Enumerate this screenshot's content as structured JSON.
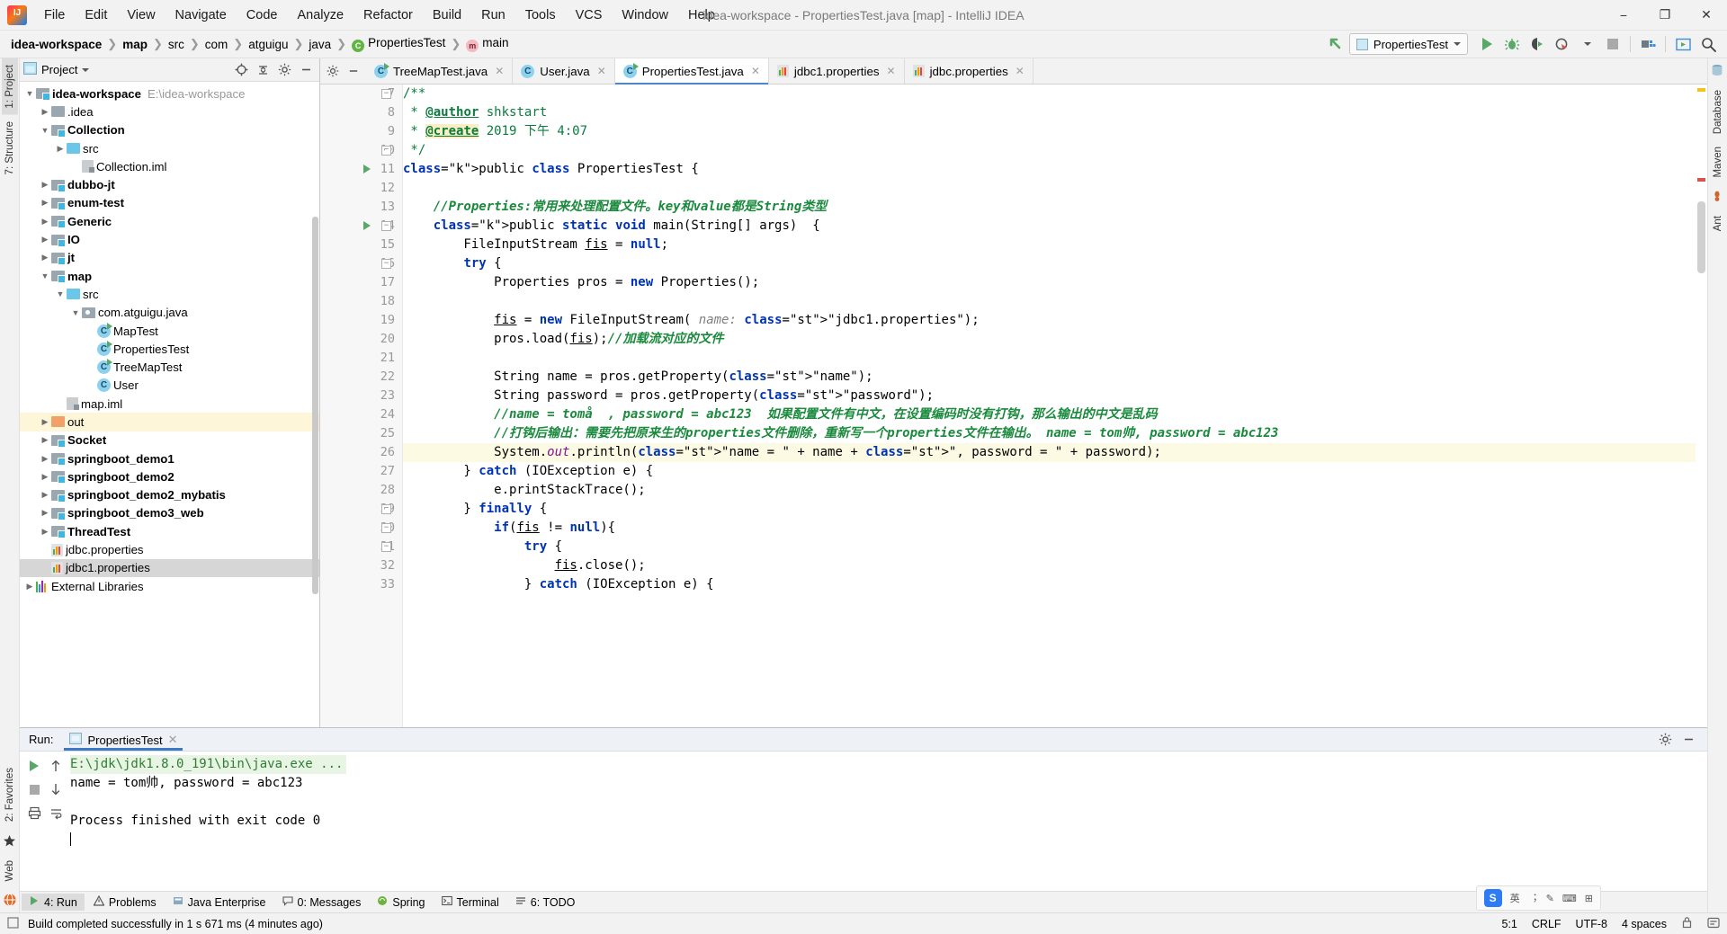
{
  "window": {
    "title": "idea-workspace - PropertiesTest.java [map] - IntelliJ IDEA",
    "minimize": "−",
    "maximize": "❐",
    "close": "✕"
  },
  "menu": [
    "File",
    "Edit",
    "View",
    "Navigate",
    "Code",
    "Analyze",
    "Refactor",
    "Build",
    "Run",
    "Tools",
    "VCS",
    "Window",
    "Help"
  ],
  "breadcrumbs": [
    {
      "label": "idea-workspace",
      "bold": true,
      "icon": ""
    },
    {
      "label": "map",
      "bold": true,
      "icon": ""
    },
    {
      "label": "src",
      "bold": false,
      "icon": ""
    },
    {
      "label": "com",
      "bold": false,
      "icon": ""
    },
    {
      "label": "atguigu",
      "bold": false,
      "icon": ""
    },
    {
      "label": "java",
      "bold": false,
      "icon": ""
    },
    {
      "label": "PropertiesTest",
      "bold": false,
      "icon": "class-icon"
    },
    {
      "label": "main",
      "bold": false,
      "icon": "method-icon"
    }
  ],
  "toolbar": {
    "run_config": "PropertiesTest",
    "buttons": [
      "run-icon",
      "debug-icon",
      "run-coverage-icon",
      "profiler-icon",
      "stop-icon",
      "build-project-icon",
      "update-icon",
      "search-everywhere-icon"
    ]
  },
  "left_rail": [
    "1: Project",
    "7: Structure"
  ],
  "left_rail_bottom": [
    "2: Favorites",
    "Web"
  ],
  "right_rail": [
    "Database",
    "Maven",
    "Ant"
  ],
  "project_panel": {
    "title": "Project",
    "header_buttons": [
      "locate-icon",
      "collapse-all-icon",
      "settings-icon",
      "hide-icon"
    ],
    "tree": [
      {
        "label": "idea-workspace",
        "path": "E:\\idea-workspace",
        "indent": 0,
        "arrow": "▼",
        "icon": "module-folder",
        "bold": true
      },
      {
        "label": ".idea",
        "indent": 1,
        "arrow": "▶",
        "icon": "folder-gray",
        "bold": false
      },
      {
        "label": "Collection",
        "indent": 1,
        "arrow": "▼",
        "icon": "module-folder",
        "bold": true
      },
      {
        "label": "src",
        "indent": 2,
        "arrow": "▶",
        "icon": "folder-blue",
        "bold": false
      },
      {
        "label": "Collection.iml",
        "indent": 3,
        "arrow": "",
        "icon": "iml-file",
        "bold": false
      },
      {
        "label": "dubbo-jt",
        "indent": 1,
        "arrow": "▶",
        "icon": "module-folder",
        "bold": true
      },
      {
        "label": "enum-test",
        "indent": 1,
        "arrow": "▶",
        "icon": "module-folder",
        "bold": true
      },
      {
        "label": "Generic",
        "indent": 1,
        "arrow": "▶",
        "icon": "module-folder",
        "bold": true
      },
      {
        "label": "IO",
        "indent": 1,
        "arrow": "▶",
        "icon": "module-folder",
        "bold": true
      },
      {
        "label": "jt",
        "indent": 1,
        "arrow": "▶",
        "icon": "module-folder",
        "bold": true
      },
      {
        "label": "map",
        "indent": 1,
        "arrow": "▼",
        "icon": "module-folder",
        "bold": true
      },
      {
        "label": "src",
        "indent": 2,
        "arrow": "▼",
        "icon": "folder-blue",
        "bold": false
      },
      {
        "label": "com.atguigu.java",
        "indent": 3,
        "arrow": "▼",
        "icon": "package-folder",
        "bold": false
      },
      {
        "label": "MapTest",
        "indent": 4,
        "arrow": "",
        "icon": "class-runnable",
        "bold": false
      },
      {
        "label": "PropertiesTest",
        "indent": 4,
        "arrow": "",
        "icon": "class-runnable",
        "bold": false
      },
      {
        "label": "TreeMapTest",
        "indent": 4,
        "arrow": "",
        "icon": "class-runnable",
        "bold": false
      },
      {
        "label": "User",
        "indent": 4,
        "arrow": "",
        "icon": "class",
        "bold": false
      },
      {
        "label": "map.iml",
        "indent": 2,
        "arrow": "",
        "icon": "iml-file",
        "bold": false
      },
      {
        "label": "out",
        "indent": 1,
        "arrow": "▶",
        "icon": "folder-orange",
        "bold": false,
        "highlight": true
      },
      {
        "label": "Socket",
        "indent": 1,
        "arrow": "▶",
        "icon": "module-folder",
        "bold": true
      },
      {
        "label": "springboot_demo1",
        "indent": 1,
        "arrow": "▶",
        "icon": "module-folder",
        "bold": true
      },
      {
        "label": "springboot_demo2",
        "indent": 1,
        "arrow": "▶",
        "icon": "module-folder",
        "bold": true
      },
      {
        "label": "springboot_demo2_mybatis",
        "indent": 1,
        "arrow": "▶",
        "icon": "module-folder",
        "bold": true
      },
      {
        "label": "springboot_demo3_web",
        "indent": 1,
        "arrow": "▶",
        "icon": "module-folder",
        "bold": true
      },
      {
        "label": "ThreadTest",
        "indent": 1,
        "arrow": "▶",
        "icon": "module-folder",
        "bold": true
      },
      {
        "label": "jdbc.properties",
        "indent": 1,
        "arrow": "",
        "icon": "properties-file",
        "bold": false
      },
      {
        "label": "jdbc1.properties",
        "indent": 1,
        "arrow": "",
        "icon": "properties-file",
        "bold": false,
        "selected": true
      },
      {
        "label": "External Libraries",
        "indent": 0,
        "arrow": "▶",
        "icon": "library-icon",
        "bold": false
      }
    ]
  },
  "editor": {
    "tabs": [
      {
        "label": "TreeMapTest.java",
        "icon": "class-runnable",
        "active": false
      },
      {
        "label": "User.java",
        "icon": "class",
        "active": false
      },
      {
        "label": "PropertiesTest.java",
        "icon": "class-runnable",
        "active": true
      },
      {
        "label": "jdbc1.properties",
        "icon": "properties-file",
        "active": false
      },
      {
        "label": "jdbc.properties",
        "icon": "properties-file",
        "active": false
      }
    ],
    "first_line_number": 7,
    "lines": [
      {
        "num": 7,
        "text": "/**",
        "kind": "javadoc",
        "gutter": "fold-open"
      },
      {
        "num": 8,
        "text": " * @author shkstart",
        "kind": "javadoc-tag",
        "tag": "@author",
        "rest": " shkstart"
      },
      {
        "num": 9,
        "text": " * @create 2019 下午 4:07",
        "kind": "javadoc-tag-hl",
        "tag": "@create",
        "rest": " 2019 下午 4:07"
      },
      {
        "num": 10,
        "text": " */",
        "kind": "javadoc",
        "gutter": "fold-close"
      },
      {
        "num": 11,
        "text": "public class PropertiesTest {",
        "kind": "code",
        "gutter": "run"
      },
      {
        "num": 12,
        "text": "",
        "kind": "code"
      },
      {
        "num": 13,
        "text": "    //Properties:常用来处理配置文件。key和value都是String类型",
        "kind": "comment"
      },
      {
        "num": 14,
        "text": "    public static void main(String[] args)  {",
        "kind": "code",
        "gutter": "run-fold"
      },
      {
        "num": 15,
        "text": "        FileInputStream fis = null;",
        "kind": "code"
      },
      {
        "num": 16,
        "text": "        try {",
        "kind": "code",
        "gutter": "fold"
      },
      {
        "num": 17,
        "text": "            Properties pros = new Properties();",
        "kind": "code"
      },
      {
        "num": 18,
        "text": "",
        "kind": "code"
      },
      {
        "num": 19,
        "text": "            fis = new FileInputStream( name: \"jdbc1.properties\");",
        "kind": "code"
      },
      {
        "num": 20,
        "text": "            pros.load(fis);//加载流对应的文件",
        "kind": "code"
      },
      {
        "num": 21,
        "text": "",
        "kind": "code"
      },
      {
        "num": 22,
        "text": "            String name = pros.getProperty(\"name\");",
        "kind": "code"
      },
      {
        "num": 23,
        "text": "            String password = pros.getProperty(\"password\");",
        "kind": "code"
      },
      {
        "num": 24,
        "text": "            //name = tomå  , password = abc123  如果配置文件有中文，在设置编码时没有打钩，那么输出的中文是乱码",
        "kind": "comment"
      },
      {
        "num": 25,
        "text": "            //打钩后输出：需要先把原来生的properties文件删除，重新写一个properties文件在输出。 name = tom帅, password = abc123",
        "kind": "comment"
      },
      {
        "num": 26,
        "text": "            System.out.println(\"name = \" + name + \", password = \" + password);",
        "kind": "code",
        "highlight": true
      },
      {
        "num": 27,
        "text": "        } catch (IOException e) {",
        "kind": "code"
      },
      {
        "num": 28,
        "text": "            e.printStackTrace();",
        "kind": "code"
      },
      {
        "num": 29,
        "text": "        } finally {",
        "kind": "code",
        "gutter": "fold-close"
      },
      {
        "num": 30,
        "text": "            if(fis != null){",
        "kind": "code",
        "gutter": "fold"
      },
      {
        "num": 31,
        "text": "                try {",
        "kind": "code",
        "gutter": "fold"
      },
      {
        "num": 32,
        "text": "                    fis.close();",
        "kind": "code"
      },
      {
        "num": 33,
        "text": "                } catch (IOException e) {",
        "kind": "code"
      }
    ]
  },
  "run_panel": {
    "label": "Run:",
    "tab": "PropertiesTest",
    "side_buttons": [
      "rerun-icon",
      "stop-icon",
      "scroll-up-icon",
      "scroll-down-icon",
      "print-icon",
      "soft-wrap-icon"
    ],
    "header_buttons": [
      "settings-icon",
      "hide-icon"
    ],
    "console": [
      {
        "text": "E:\\jdk\\jdk1.8.0_191\\bin\\java.exe ...",
        "style": "command"
      },
      {
        "text": "name = tom帅, password = abc123",
        "style": "normal"
      },
      {
        "text": "",
        "style": "normal"
      },
      {
        "text": "Process finished with exit code 0",
        "style": "normal"
      },
      {
        "text": "",
        "style": "caret"
      }
    ]
  },
  "tool_strip": [
    {
      "label": "4: Run",
      "icon": "run-icon",
      "active": true
    },
    {
      "label": "Problems",
      "icon": "warning-icon",
      "active": false
    },
    {
      "label": "Java Enterprise",
      "icon": "java-ee-icon",
      "active": false
    },
    {
      "label": "0: Messages",
      "icon": "messages-icon",
      "active": false
    },
    {
      "label": "Spring",
      "icon": "spring-icon",
      "active": false
    },
    {
      "label": "Terminal",
      "icon": "terminal-icon",
      "active": false
    },
    {
      "label": "6: TODO",
      "icon": "todo-icon",
      "active": false
    }
  ],
  "status_bar": {
    "message": "Build completed successfully in 1 s 671 ms (4 minutes ago)",
    "caret_position": "5:1",
    "line_separator": "CRLF",
    "encoding": "UTF-8",
    "indent": "4 spaces",
    "icons": [
      "lock-icon",
      "event-log-icon"
    ]
  },
  "ime": {
    "items": [
      "英",
      "︔",
      "✎",
      "⌨",
      "⊞"
    ],
    "logo": "S"
  },
  "colors": {
    "accent": "#4a87c9",
    "run_green": "#59a869",
    "string_green": "#067d17",
    "keyword_blue": "#0033b3",
    "comment_gray": "#8c8c8c",
    "javadoc_green": "#0a7c3e",
    "selection_gray": "#d6d6d6",
    "highlight_yellow": "#fcfae3"
  }
}
